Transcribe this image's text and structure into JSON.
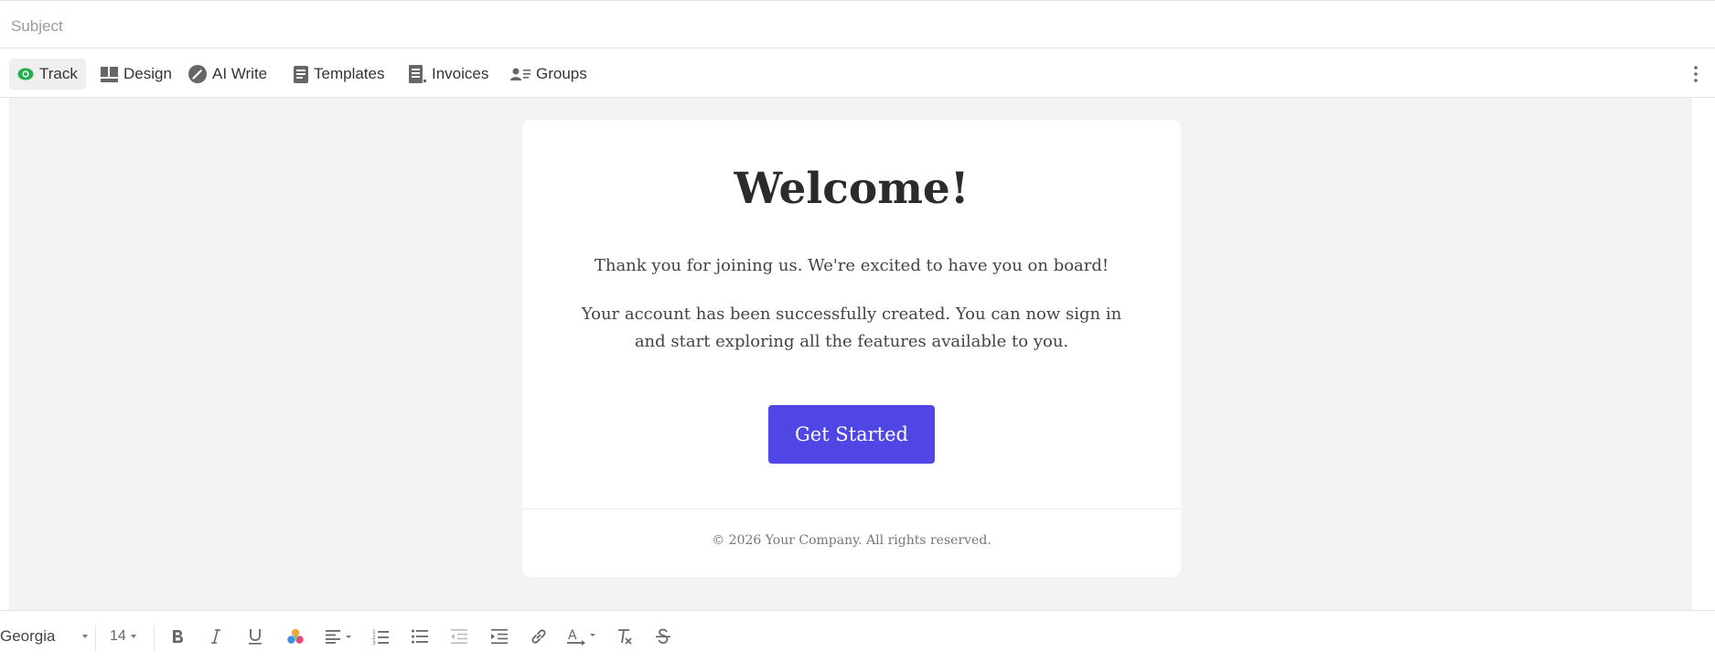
{
  "subject": {
    "placeholder": "Subject",
    "value": ""
  },
  "toolbar": {
    "items": [
      {
        "label": "Track",
        "icon": "eye-icon",
        "active": true
      },
      {
        "label": "Design",
        "icon": "layout-icon"
      },
      {
        "label": "AI Write",
        "icon": "magic-wand-icon"
      },
      {
        "label": "Templates",
        "icon": "document-icon"
      },
      {
        "label": "Invoices",
        "icon": "invoice-icon"
      },
      {
        "label": "Groups",
        "icon": "groups-icon"
      }
    ],
    "more_icon": "more-vertical-icon"
  },
  "email": {
    "heading": "Welcome!",
    "paragraph1": "Thank you for joining us. We're excited to have you on board!",
    "paragraph2": "Your account has been successfully created. You can now sign in and start exploring all the features available to you.",
    "cta_label": "Get Started",
    "footer": "© 2026 Your Company. All rights reserved."
  },
  "format_bar": {
    "font": "Georgia",
    "size": "14",
    "tools": [
      "bold-icon",
      "italic-icon",
      "underline-icon",
      "color-palette-icon",
      "align-icon",
      "ordered-list-icon",
      "bullet-list-icon",
      "outdent-icon",
      "indent-icon",
      "link-icon",
      "text-color-icon",
      "clear-format-icon",
      "strikethrough-icon"
    ]
  },
  "colors": {
    "accent": "#4f46e5",
    "track_green": "#22b14c",
    "canvas_bg": "#f3f3f3"
  }
}
